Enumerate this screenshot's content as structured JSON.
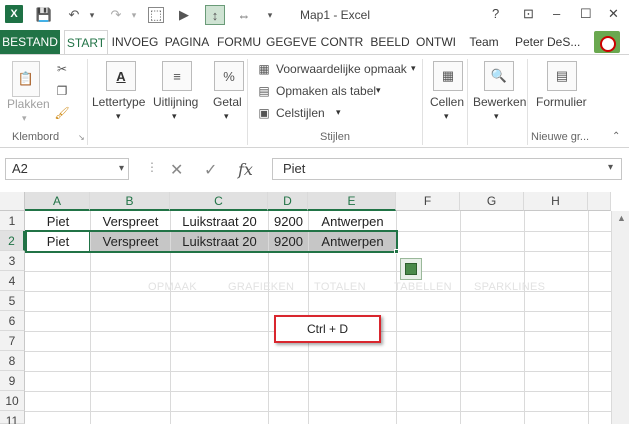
{
  "title": "Map1 - Excel",
  "window": {
    "help": "?",
    "minimize": "–",
    "maximize": "☐",
    "close": "✕"
  },
  "qat": {
    "logo": "X",
    "save_icon": "save-icon",
    "undo_icon": "undo-icon",
    "redo_icon": "redo-icon"
  },
  "tabs": [
    "BESTAND",
    "START",
    "INVOEG",
    "PAGINA",
    "FORMU",
    "GEGEVE",
    "CONTR",
    "BEELD",
    "ONTWI",
    "Team"
  ],
  "user": "Peter DeS...",
  "ribbon": {
    "paste": "Plakken",
    "clipboard_group": "Klembord",
    "font": "Lettertype",
    "alignment": "Uitlijning",
    "number": "Getal",
    "number_icon": "%",
    "cond_format": "Voorwaardelijke opmaak",
    "format_table": "Opmaken als tabel",
    "cell_styles": "Celstijlen",
    "styles_group": "Stijlen",
    "cells": "Cellen",
    "editing": "Bewerken",
    "forms": "Formulier",
    "new_group": "Nieuwe gr..."
  },
  "formula_bar": {
    "name_box": "A2",
    "fx": "fx",
    "value": "Piet"
  },
  "grid": {
    "columns": [
      "A",
      "B",
      "C",
      "D",
      "E",
      "F",
      "G",
      "H"
    ],
    "rows": [
      "1",
      "2",
      "3",
      "4",
      "5",
      "6",
      "7",
      "8",
      "9",
      "10",
      "11"
    ],
    "row1": [
      "Piet",
      "Verspreet",
      "Luikstraat 20",
      "9200",
      "Antwerpen"
    ],
    "row2": [
      "Piet",
      "Verspreet",
      "Luikstraat 20",
      "9200",
      "Antwerpen"
    ]
  },
  "quick_analysis": [
    "OPMAAK",
    "GRAFIEKEN",
    "TOTALEN",
    "TABELLEN",
    "SPARKLINES"
  ],
  "shortcut": "Ctrl + D",
  "colors": {
    "accent": "#217346",
    "highlight_border": "#d9262e"
  }
}
